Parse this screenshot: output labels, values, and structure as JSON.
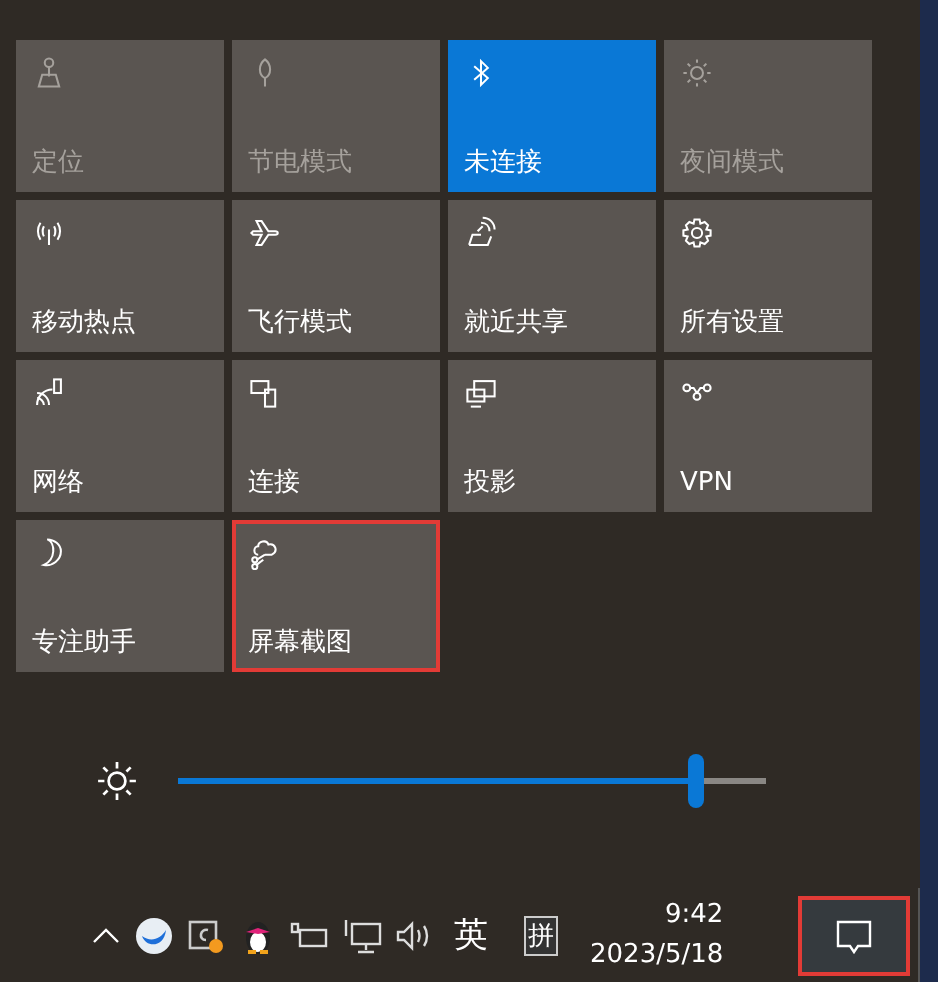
{
  "tiles": [
    {
      "label": "定位",
      "disabled": true,
      "on": false,
      "highlighted": false
    },
    {
      "label": "节电模式",
      "disabled": true,
      "on": false,
      "highlighted": false
    },
    {
      "label": "未连接",
      "disabled": false,
      "on": true,
      "highlighted": false
    },
    {
      "label": "夜间模式",
      "disabled": true,
      "on": false,
      "highlighted": false
    },
    {
      "label": "移动热点",
      "disabled": false,
      "on": false,
      "highlighted": false
    },
    {
      "label": "飞行模式",
      "disabled": false,
      "on": false,
      "highlighted": false
    },
    {
      "label": "就近共享",
      "disabled": false,
      "on": false,
      "highlighted": false
    },
    {
      "label": "所有设置",
      "disabled": false,
      "on": false,
      "highlighted": false
    },
    {
      "label": "网络",
      "disabled": false,
      "on": false,
      "highlighted": false
    },
    {
      "label": "连接",
      "disabled": false,
      "on": false,
      "highlighted": false
    },
    {
      "label": "投影",
      "disabled": false,
      "on": false,
      "highlighted": false
    },
    {
      "label": "VPN",
      "disabled": false,
      "on": false,
      "highlighted": false
    },
    {
      "label": "专注助手",
      "disabled": false,
      "on": false,
      "highlighted": false
    },
    {
      "label": "屏幕截图",
      "disabled": false,
      "on": false,
      "highlighted": true
    }
  ],
  "brightness": {
    "level": 0.88
  },
  "taskbar": {
    "input_mode": "英",
    "ime": "拼",
    "time": "9:42",
    "date": "2023/5/18",
    "notification_highlighted": true
  }
}
